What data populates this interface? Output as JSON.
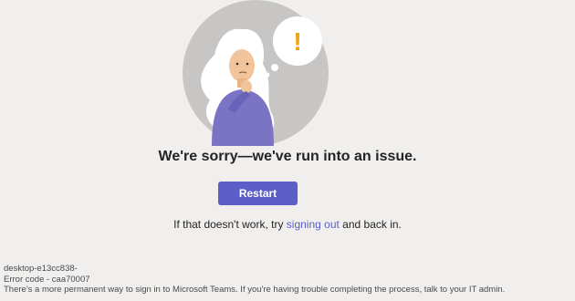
{
  "error_page": {
    "headline": "We're sorry—we've run into an issue.",
    "restart_label": "Restart",
    "fallback": {
      "prefix": "If that doesn't work, try ",
      "link": "signing out",
      "suffix": " and back in."
    },
    "footer": {
      "device": "desktop-e13cc838-",
      "error_code": "Error code - caa70007",
      "help_text": "There's a more permanent way to sign in to Microsoft Teams. If you're having trouble completing the process, talk to your IT admin."
    },
    "alert_symbol": "!"
  },
  "colors": {
    "background": "#f0efee",
    "accent": "#5b5fc7",
    "alert": "#f0a30a",
    "circle": "#c7c6c5",
    "sweater": "#7b73c4"
  },
  "icons": {
    "illustration": "confused-person-illustration",
    "alert": "exclamation-bubble-icon"
  }
}
